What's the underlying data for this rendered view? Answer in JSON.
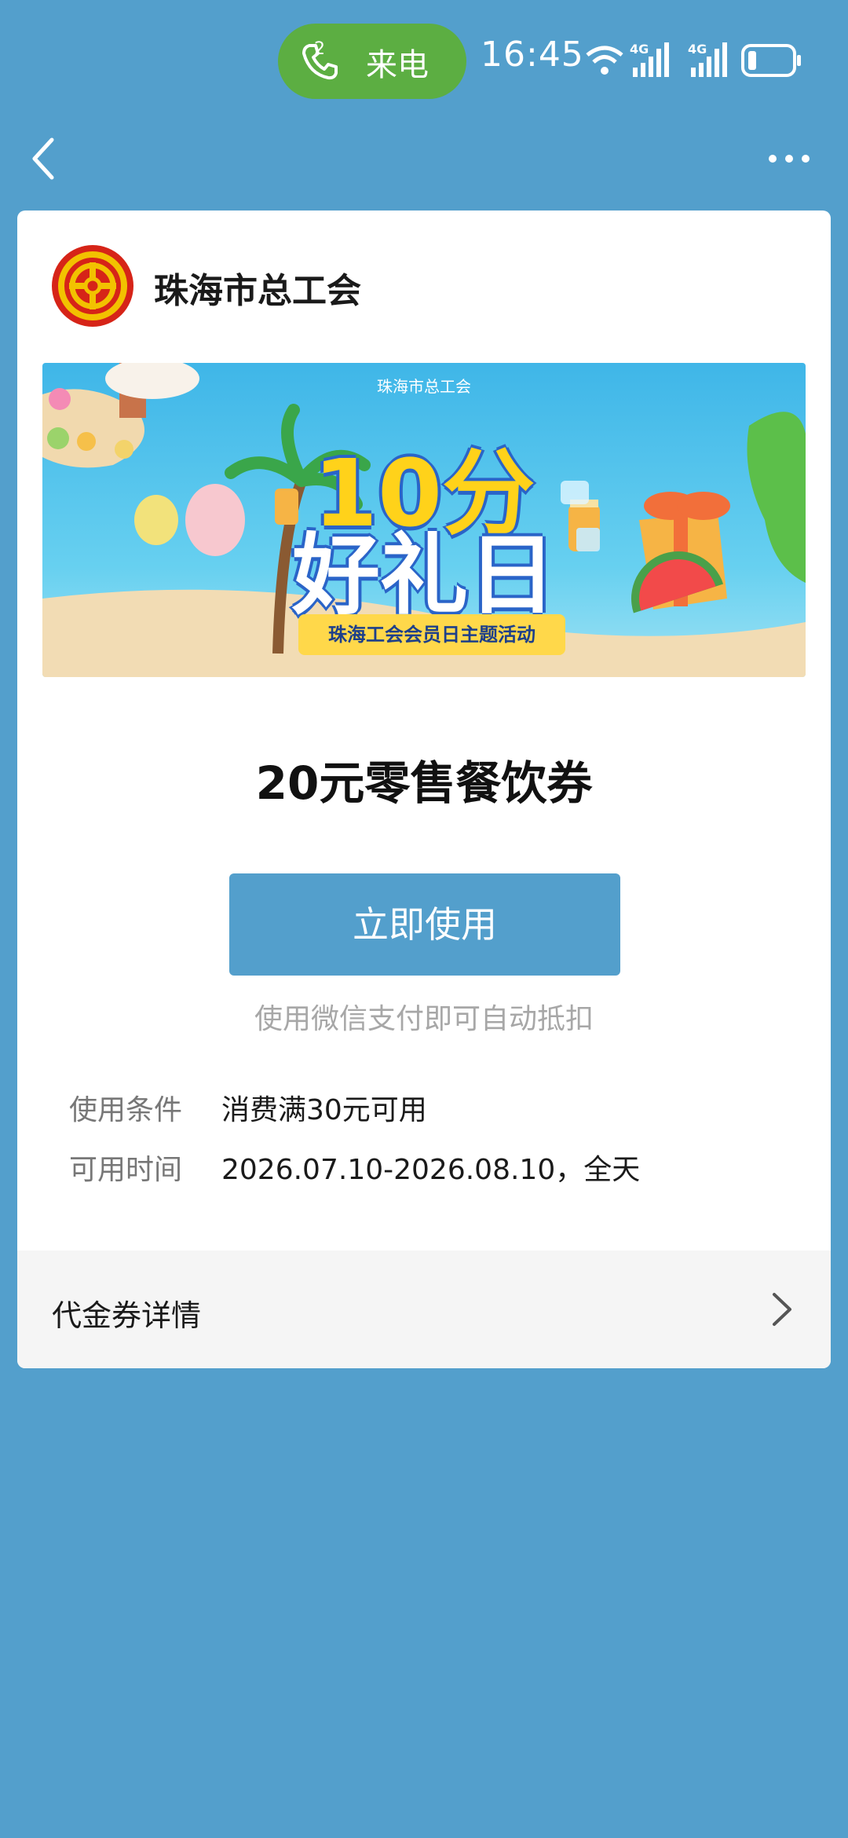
{
  "status_bar": {
    "call_label": "来电",
    "call_count": "2",
    "time": "16:45",
    "network_1": "4G",
    "network_2": "4G"
  },
  "header": {
    "org_name": "珠海市总工会"
  },
  "banner": {
    "org_text": "珠海市总工会",
    "title_line1": "10分",
    "title_line2": "好礼日",
    "ribbon": "珠海工会会员日主题活动"
  },
  "coupon": {
    "title": "20元零售餐饮券",
    "button_label": "立即使用",
    "hint": "使用微信支付即可自动抵扣",
    "condition_label": "使用条件",
    "condition_value": "消费满30元可用",
    "time_label": "可用时间",
    "time_value": "2026.07.10-2026.08.10，全天",
    "details_label": "代金券详情"
  },
  "colors": {
    "background": "#539fcc",
    "button": "#539fcc",
    "call_pill": "#5cae42",
    "logo_red": "#d62418",
    "logo_yellow": "#f2c200"
  }
}
